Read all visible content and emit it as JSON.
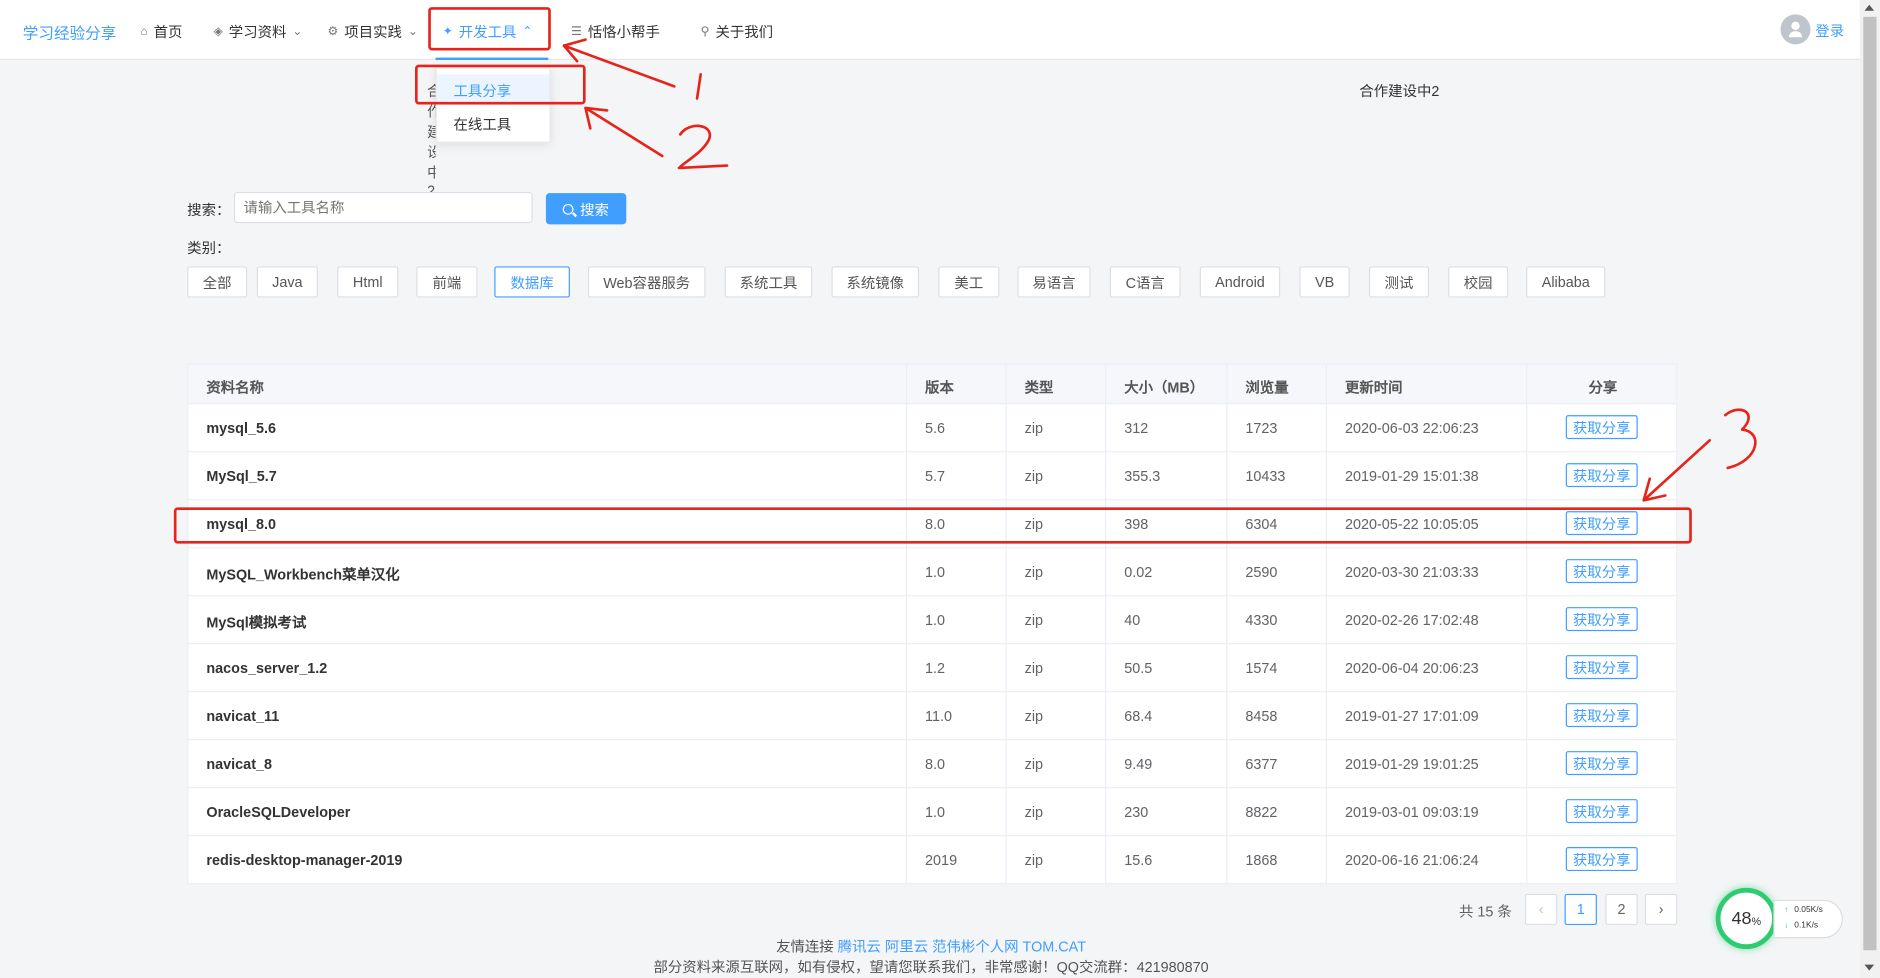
{
  "nav": {
    "brand": "学习经验分享",
    "items": [
      {
        "label": "首页",
        "icon": "home-icon"
      },
      {
        "label": "学习资料",
        "icon": "layers-icon"
      },
      {
        "label": "项目实践",
        "icon": "settings-icon"
      },
      {
        "label": "开发工具",
        "icon": "tools-icon"
      },
      {
        "label": "恬恪小帮手",
        "icon": "help-icon"
      },
      {
        "label": "关于我们",
        "icon": "share-icon"
      }
    ],
    "login": "登录"
  },
  "dropdown": {
    "items": [
      "工具分享",
      "在线工具"
    ],
    "selected": "工具分享"
  },
  "partner_text": "合作建设中2",
  "search": {
    "label": "搜索：",
    "placeholder": "请输入工具名称",
    "button": "搜索"
  },
  "category": {
    "label": "类别：",
    "items": [
      "全部",
      "Java",
      "Html",
      "前端",
      "数据库",
      "Web容器服务",
      "系统工具",
      "系统镜像",
      "美工",
      "易语言",
      "C语言",
      "Android",
      "VB",
      "测试",
      "校园",
      "Alibaba"
    ],
    "selected": "数据库"
  },
  "table": {
    "headers": [
      "资料名称",
      "版本",
      "类型",
      "大小（MB）",
      "浏览量",
      "更新时间",
      "分享"
    ],
    "share_label": "获取分享",
    "rows": [
      {
        "name": "mysql_5.6",
        "version": "5.6",
        "type": "zip",
        "size": "312",
        "views": "1723",
        "updated": "2020-06-03 22:06:23"
      },
      {
        "name": "MySql_5.7",
        "version": "5.7",
        "type": "zip",
        "size": "355.3",
        "views": "10433",
        "updated": "2019-01-29 15:01:38"
      },
      {
        "name": "mysql_8.0",
        "version": "8.0",
        "type": "zip",
        "size": "398",
        "views": "6304",
        "updated": "2020-05-22 10:05:05"
      },
      {
        "name": "MySQL_Workbench菜单汉化",
        "version": "1.0",
        "type": "zip",
        "size": "0.02",
        "views": "2590",
        "updated": "2020-03-30 21:03:33"
      },
      {
        "name": "MySql模拟考试",
        "version": "1.0",
        "type": "zip",
        "size": "40",
        "views": "4330",
        "updated": "2020-02-26 17:02:48"
      },
      {
        "name": "nacos_server_1.2",
        "version": "1.2",
        "type": "zip",
        "size": "50.5",
        "views": "1574",
        "updated": "2020-06-04 20:06:23"
      },
      {
        "name": "navicat_11",
        "version": "11.0",
        "type": "zip",
        "size": "68.4",
        "views": "8458",
        "updated": "2019-01-27 17:01:09"
      },
      {
        "name": "navicat_8",
        "version": "8.0",
        "type": "zip",
        "size": "9.49",
        "views": "6377",
        "updated": "2019-01-29 19:01:25"
      },
      {
        "name": "OracleSQLDeveloper",
        "version": "1.0",
        "type": "zip",
        "size": "230",
        "views": "8822",
        "updated": "2019-03-01 09:03:19"
      },
      {
        "name": "redis-desktop-manager-2019",
        "version": "2019",
        "type": "zip",
        "size": "15.6",
        "views": "1868",
        "updated": "2020-06-16 21:06:24"
      }
    ]
  },
  "pagination": {
    "total_label": "共 15 条",
    "pages": [
      "1",
      "2"
    ],
    "current": "1",
    "prev": "‹",
    "next": "›"
  },
  "footer": {
    "friends_label": "友情连接",
    "links": [
      "腾讯云",
      "阿里云",
      "范伟彬个人网",
      "TOM.CAT"
    ],
    "notice": "部分资料来源互联网，如有侵权，望请您联系我们，非常感谢！QQ交流群：421980870"
  },
  "speed": {
    "percent": "48",
    "percent_sign": "%",
    "up": "0.05K/s",
    "down": "0.1K/s"
  },
  "annotations": {
    "labels": [
      "1",
      "2",
      "3"
    ],
    "color": "#e8231a"
  },
  "colors": {
    "primary": "#409eff",
    "annotation": "#e8231a",
    "speed_ring": "#2ecc71"
  }
}
